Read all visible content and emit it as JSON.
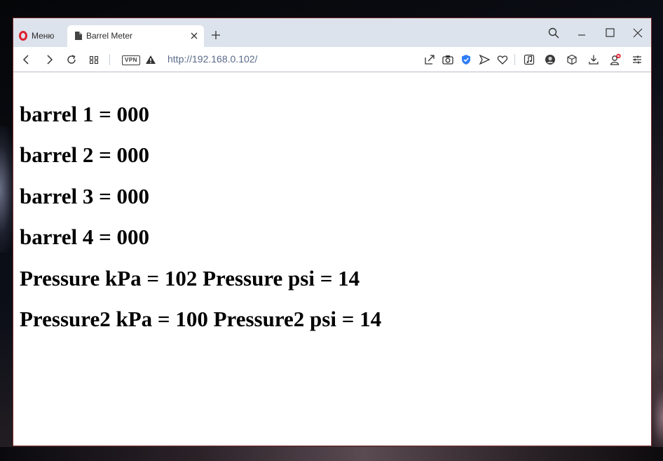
{
  "browser": {
    "menu_label": "Меню",
    "tab_title": "Barrel Meter",
    "vpn_label": "VPN",
    "address": "http://192.168.0.102/"
  },
  "page": {
    "lines": [
      "barrel 1 = 000",
      "barrel 2 = 000",
      "barrel 3 = 000",
      "barrel 4 = 000",
      "Pressure kPa = 102 Pressure psi = 14",
      "Pressure2 kPa = 100 Pressure2 psi = 14"
    ]
  },
  "colors": {
    "opera_red": "#e0202e",
    "shield_blue": "#2f7cf6",
    "badge_red": "#e0202e"
  },
  "icons": [
    "opera-logo-icon",
    "document-icon",
    "close-icon",
    "plus-icon",
    "search-icon",
    "minimize-icon",
    "maximize-icon",
    "window-close-icon",
    "back-icon",
    "forward-icon",
    "reload-icon",
    "tabs-grid-icon",
    "warning-icon",
    "share-icon",
    "camera-icon",
    "shield-icon",
    "send-icon",
    "heart-icon",
    "music-icon",
    "avatar-icon",
    "cube-icon",
    "download-icon",
    "profile-icon",
    "settings-sliders-icon"
  ]
}
